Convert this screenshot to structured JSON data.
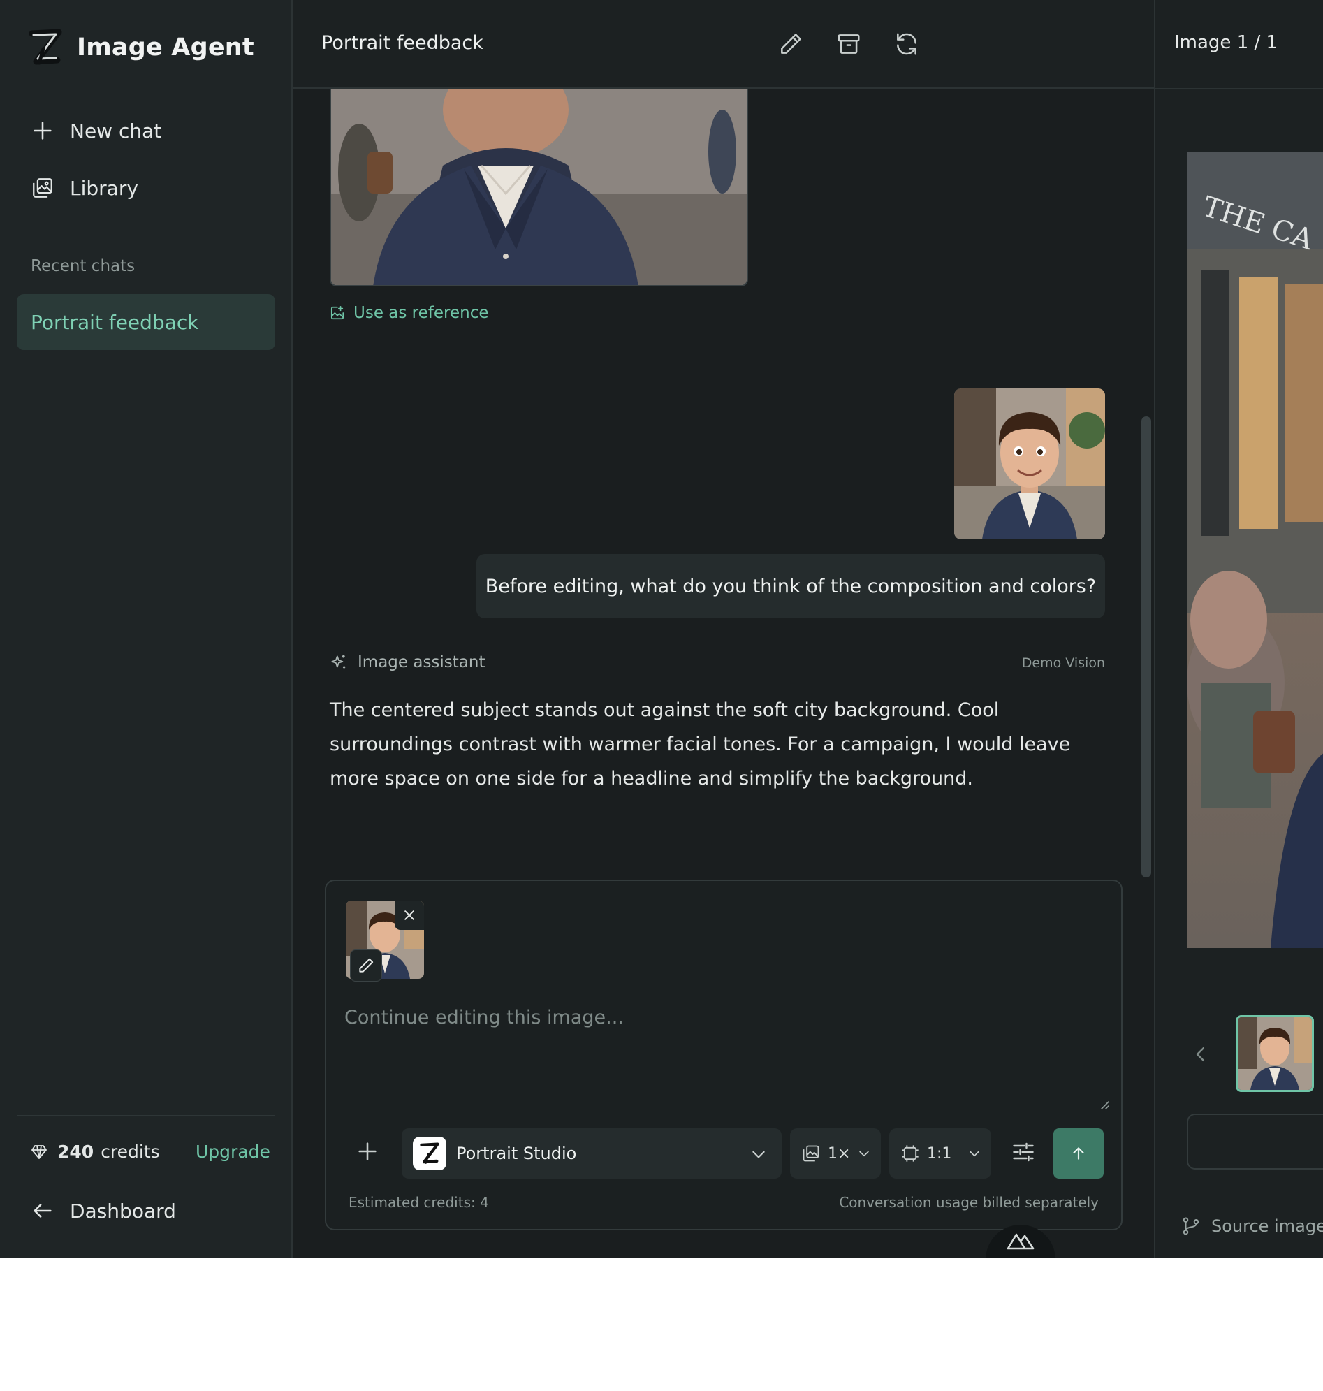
{
  "app": {
    "name": "Image Agent"
  },
  "sidebar": {
    "new_chat": "New chat",
    "library": "Library",
    "recent_label": "Recent chats",
    "recent_chats": [
      "Portrait feedback"
    ],
    "credits_count": "240",
    "credits_label": "credits",
    "upgrade": "Upgrade",
    "dashboard": "Dashboard"
  },
  "header": {
    "title": "Portrait feedback",
    "icons": [
      "pencil-icon",
      "archive-icon",
      "refresh-icon"
    ]
  },
  "thread": {
    "use_reference": "Use as reference",
    "user_message": "Before editing, what do you think of the composition and colors?",
    "assistant_name": "Image assistant",
    "assistant_model": "Demo Vision",
    "assistant_message": "The centered subject stands out against the soft city background. Cool surroundings contrast with warmer facial tones. For a campaign, I would leave more space on one side for a headline and simplify the background."
  },
  "composer": {
    "placeholder": "Continue editing this image...",
    "model": "Portrait Studio",
    "count": "1×",
    "ratio": "1:1",
    "estimated": "Estimated credits: 4",
    "billing_note": "Conversation usage billed separately"
  },
  "right_panel": {
    "title": "Image 1 / 1",
    "source_images": "Source images"
  },
  "colors": {
    "accent": "#6fc5a7",
    "send": "#3d7a66",
    "background": "#1a1e1f",
    "sidebar": "#1f2526"
  }
}
